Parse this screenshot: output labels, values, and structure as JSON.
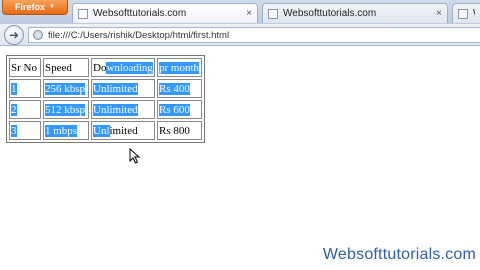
{
  "browser": {
    "menu_label": "Firefox",
    "tabs": [
      {
        "label": "Websofttutorials.com",
        "active": true
      },
      {
        "label": "Websofttutorials.com",
        "active": false
      },
      {
        "label": "Websofttutorials.com",
        "active": false
      }
    ],
    "url": "file:///C:/Users/rishik/Desktop/html/first.html"
  },
  "table": {
    "rows": [
      [
        [
          {
            "t": "Sr No",
            "s": false
          }
        ],
        [
          {
            "t": "Speed",
            "s": false
          }
        ],
        [
          {
            "t": "Do",
            "s": false
          },
          {
            "t": "wnloading",
            "s": true
          }
        ],
        [
          {
            "t": "pr month",
            "s": true
          }
        ]
      ],
      [
        [
          {
            "t": "1",
            "s": true
          }
        ],
        [
          {
            "t": "256 kbsp",
            "s": true
          }
        ],
        [
          {
            "t": "Unlimited",
            "s": true
          }
        ],
        [
          {
            "t": "Rs 400",
            "s": true
          }
        ]
      ],
      [
        [
          {
            "t": "2",
            "s": true
          }
        ],
        [
          {
            "t": "512 kbsp",
            "s": true
          }
        ],
        [
          {
            "t": "Unlimited",
            "s": true
          }
        ],
        [
          {
            "t": "Rs 600",
            "s": true
          }
        ]
      ],
      [
        [
          {
            "t": "3",
            "s": true
          }
        ],
        [
          {
            "t": "1 mbps",
            "s": true
          }
        ],
        [
          {
            "t": "Unl",
            "s": true
          },
          {
            "t": "imited",
            "s": false
          }
        ],
        [
          {
            "t": "Rs 800",
            "s": false
          }
        ]
      ]
    ]
  },
  "watermark": "Websofttutorials.com",
  "colors": {
    "selection": "#3399ff",
    "watermark": "#2f5fa8"
  }
}
